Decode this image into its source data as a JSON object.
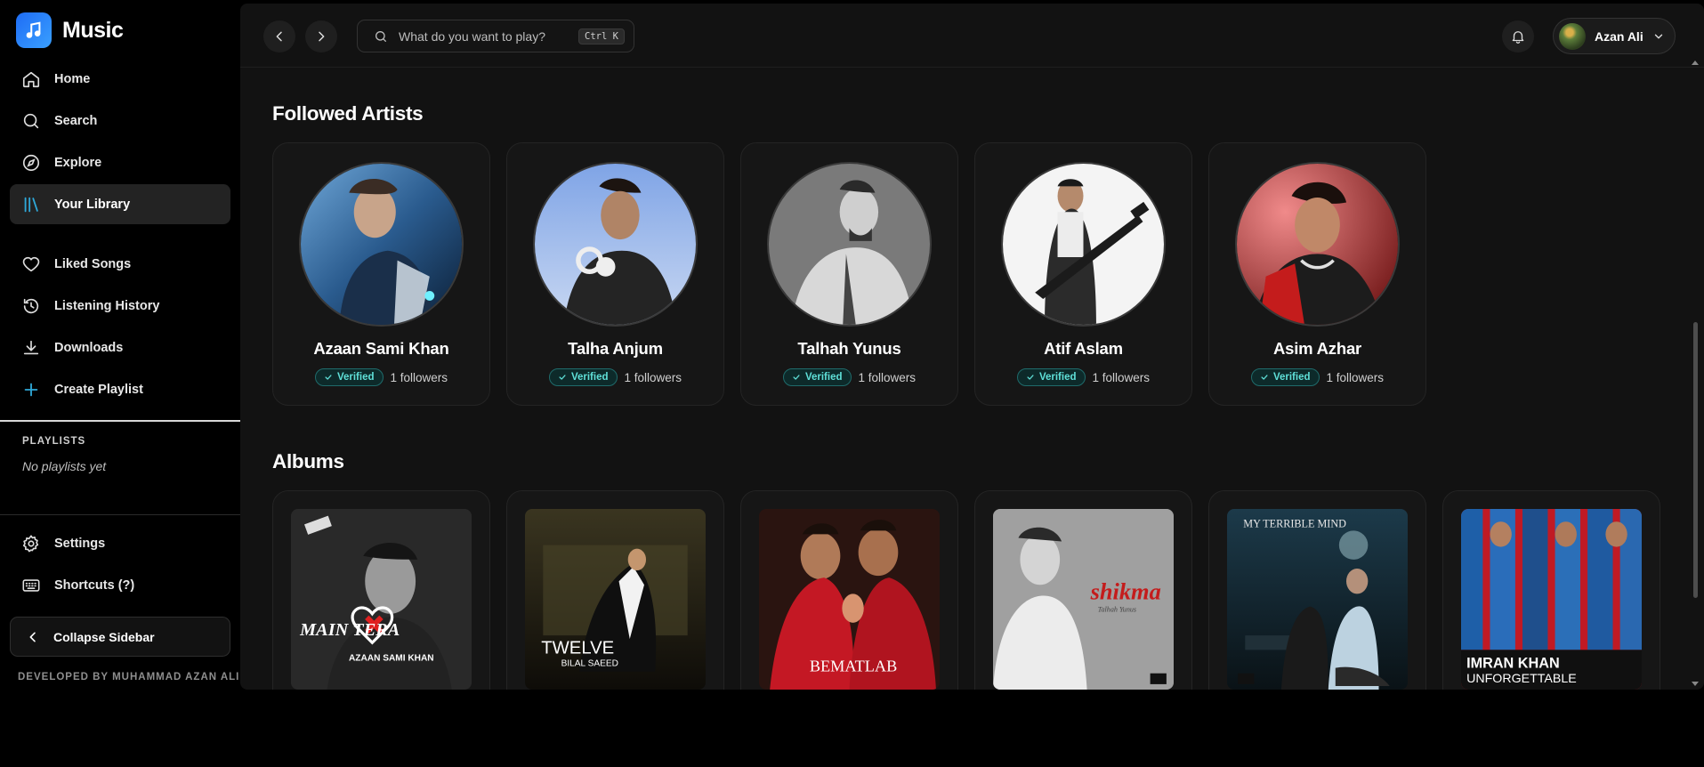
{
  "app": {
    "name": "Music"
  },
  "nav": {
    "home": "Home",
    "search": "Search",
    "explore": "Explore",
    "library": "Your Library",
    "liked": "Liked Songs",
    "history": "Listening History",
    "downloads": "Downloads",
    "create": "Create Playlist"
  },
  "playlists": {
    "heading": "PLAYLISTS",
    "empty": "No playlists yet"
  },
  "footer_nav": {
    "settings": "Settings",
    "shortcuts": "Shortcuts (?)",
    "collapse": "Collapse Sidebar"
  },
  "credit": "DEVELOPED BY MUHAMMAD AZAN ALI",
  "topbar": {
    "search_placeholder": "What do you want to play?",
    "shortcut": "Ctrl K",
    "user_name": "Azan Ali"
  },
  "sections": {
    "artists": "Followed Artists",
    "albums": "Albums"
  },
  "artists": [
    {
      "name": "Azaan Sami Khan",
      "badge": "Verified",
      "followers": "1 followers"
    },
    {
      "name": "Talha Anjum",
      "badge": "Verified",
      "followers": "1 followers"
    },
    {
      "name": "Talhah Yunus",
      "badge": "Verified",
      "followers": "1 followers"
    },
    {
      "name": "Atif Aslam",
      "badge": "Verified",
      "followers": "1 followers"
    },
    {
      "name": "Asim Azhar",
      "badge": "Verified",
      "followers": "1 followers"
    }
  ],
  "albums": [
    {
      "art_text": "MAIN TERA",
      "art_sub": "AZAAN SAMI KHAN"
    },
    {
      "art_text": "TWELVE",
      "art_sub": "BILAL SAEED"
    },
    {
      "art_text": "BEMATLAB",
      "art_sub": ""
    },
    {
      "art_text": "shikma",
      "art_sub": "Talhah Yunus"
    },
    {
      "art_text": "MY TERRIBLE MIND",
      "art_sub": ""
    },
    {
      "art_text": "IMRAN KHAN",
      "art_sub": "UNFORGETTABLE"
    }
  ],
  "colors": {
    "accent": "#1e6cf5",
    "verified": "#5fe0d8",
    "surface": "#121212"
  }
}
